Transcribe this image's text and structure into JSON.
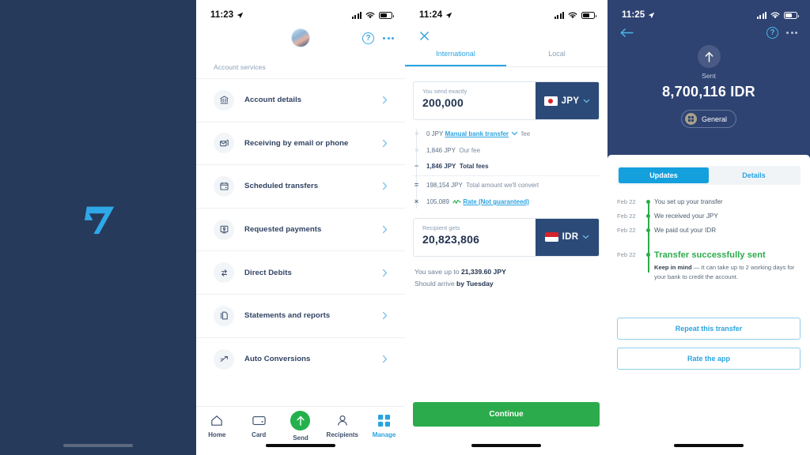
{
  "brand": {
    "logo_name": "transferwise-logo",
    "bg": "#263a5c",
    "logo_color": "#2fa8e8"
  },
  "panel_accounts": {
    "status": {
      "time": "11:23",
      "location_icon": "location-arrow-icon",
      "signal_icon": "cellular-bars-icon",
      "wifi_icon": "wifi-icon",
      "battery_icon": "battery-icon"
    },
    "avatar_name": "user-avatar",
    "help_label": "?",
    "section_title": "Account services",
    "items": [
      {
        "label": "Account details",
        "icon": "bank-icon"
      },
      {
        "label": "Receiving by email or phone",
        "icon": "envelope-card-icon"
      },
      {
        "label": "Scheduled transfers",
        "icon": "calendar-icon"
      },
      {
        "label": "Requested payments",
        "icon": "request-money-icon"
      },
      {
        "label": "Direct Debits",
        "icon": "recurring-arrows-icon"
      },
      {
        "label": "Statements and reports",
        "icon": "documents-icon"
      },
      {
        "label": "Auto Conversions",
        "icon": "trend-arrow-icon"
      }
    ],
    "tabs": [
      {
        "label": "Home",
        "icon": "home-icon",
        "active": false
      },
      {
        "label": "Card",
        "icon": "card-icon",
        "active": false
      },
      {
        "label": "Send",
        "icon": "send-up-arrow-icon",
        "active": false
      },
      {
        "label": "Recipients",
        "icon": "person-icon",
        "active": false
      },
      {
        "label": "Manage",
        "icon": "grid-icon",
        "active": true
      }
    ]
  },
  "panel_send": {
    "status": {
      "time": "11:24"
    },
    "close_label": "×",
    "tabs": [
      {
        "label": "International",
        "active": true
      },
      {
        "label": "Local",
        "active": false
      }
    ],
    "send_card": {
      "caption": "You send exactly",
      "value": "200,000",
      "currency": "JPY",
      "flag": "japan-flag"
    },
    "fees": [
      {
        "amount": "0 JPY",
        "link": "Manual bank transfer",
        "suffix": "fee",
        "marker": "dot",
        "strong": false
      },
      {
        "amount": "1,846 JPY",
        "text": "Our fee",
        "marker": "dot",
        "strong": false
      },
      {
        "amount": "1,846 JPY",
        "text": "Total fees",
        "marker": "−",
        "strong": true
      },
      {
        "amount": "198,154 JPY",
        "text": "Total amount we'll convert",
        "marker": "=",
        "strong": false
      },
      {
        "amount": "105.089",
        "link": "Rate (Not guaranteed)",
        "marker": "×",
        "strong": false,
        "zigzag": true
      }
    ],
    "recipient_card": {
      "caption": "Recipient gets",
      "value": "20,823,806",
      "currency": "IDR",
      "flag": "indonesia-flag"
    },
    "save_note_prefix": "You save up to ",
    "save_note_value": "21,339.60 JPY",
    "arrive_prefix": "Should arrive ",
    "arrive_value": "by Tuesday",
    "continue_label": "Continue"
  },
  "panel_receipt": {
    "status": {
      "time": "11:25"
    },
    "back_icon": "back-arrow-icon",
    "sent_label": "Sent",
    "sent_amount": "8,700,116 IDR",
    "chip_label": "General",
    "segments": [
      {
        "label": "Updates",
        "active": true
      },
      {
        "label": "Details",
        "active": false
      }
    ],
    "timeline": [
      {
        "date": "Feb 22",
        "text": "You set up your transfer"
      },
      {
        "date": "Feb 22",
        "text": "We received your JPY"
      },
      {
        "date": "Feb 22",
        "text": "We paid out your IDR"
      }
    ],
    "final": {
      "date": "Feb 22",
      "title": "Transfer successfully sent",
      "note_bold": "Keep in mind",
      "note_rest": " — It can take up to 2 working days for your bank to credit the account."
    },
    "buttons": [
      {
        "label": "Repeat this transfer"
      },
      {
        "label": "Rate the app"
      }
    ]
  }
}
